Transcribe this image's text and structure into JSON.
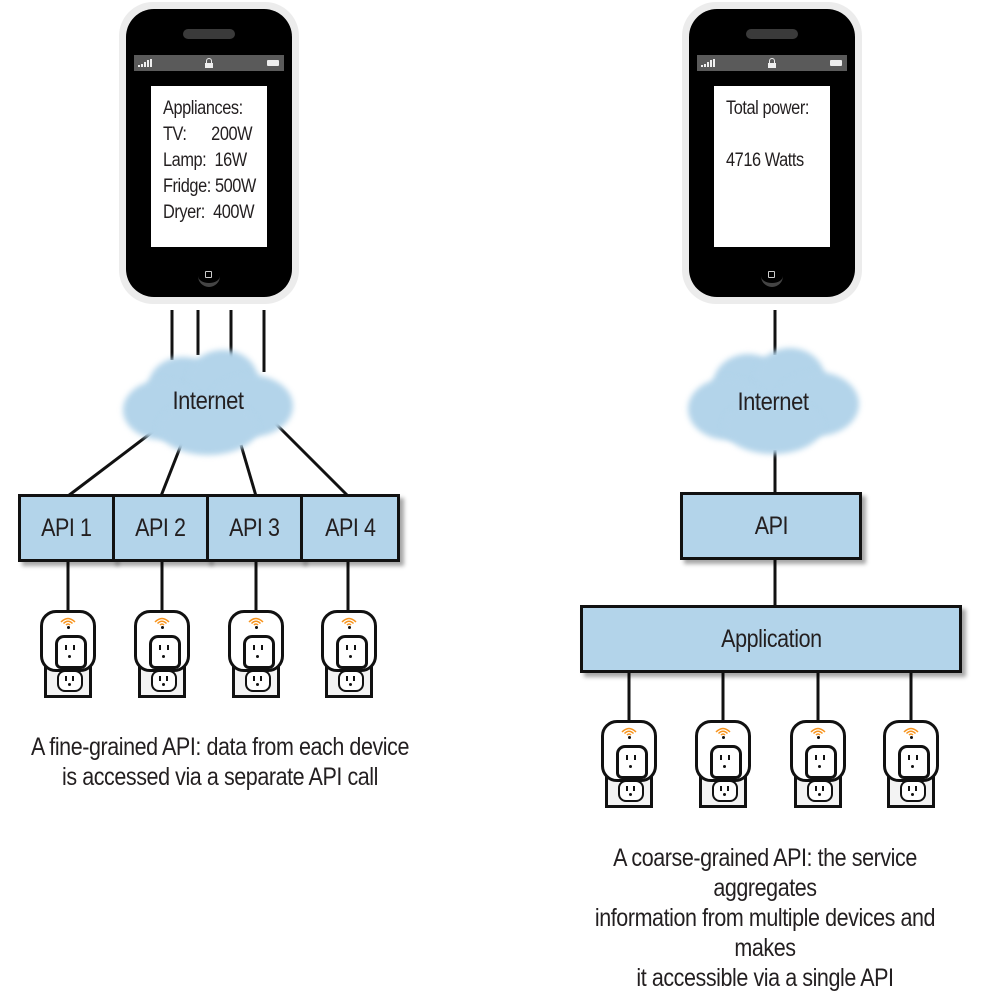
{
  "left_panel": {
    "phone": {
      "screen_lines": [
        "Appliances:",
        "TV:      200W",
        "Lamp:  16W",
        "Fridge: 500W",
        "Dryer:  400W"
      ],
      "appliances": [
        {
          "name": "TV",
          "power": "200W"
        },
        {
          "name": "Lamp",
          "power": "16W"
        },
        {
          "name": "Fridge",
          "power": "500W"
        },
        {
          "name": "Dryer",
          "power": "400W"
        }
      ]
    },
    "cloud_label": "Internet",
    "apis": [
      "API 1",
      "API 2",
      "API 3",
      "API 4"
    ],
    "device_count": 4,
    "caption": [
      "A fine-grained API: data from each device",
      "is accessed via a separate API call"
    ]
  },
  "right_panel": {
    "phone": {
      "screen_lines": [
        "Total power:",
        "",
        "4716 Watts"
      ]
    },
    "cloud_label": "Internet",
    "api_label": "API",
    "application_label": "Application",
    "device_count": 4,
    "caption": [
      "A coarse-grained API: the service aggregates",
      "information from multiple devices and makes",
      "it accessible via a single API"
    ]
  },
  "colors": {
    "box_fill": "#b3d4ea",
    "cloud_fill": "#b3d4ea",
    "wifi_accent": "#f7941d",
    "line": "#111111"
  }
}
